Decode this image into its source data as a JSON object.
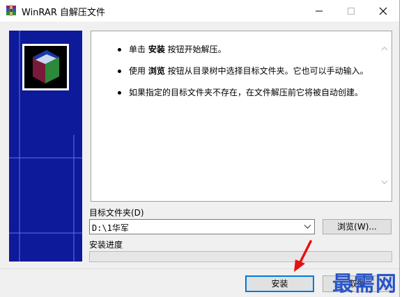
{
  "window": {
    "title": "WinRAR 自解压文件"
  },
  "info": {
    "bullets": [
      {
        "pre": "单击 ",
        "strong": "安装",
        "post": " 按钮开始解压。"
      },
      {
        "pre": "使用 ",
        "strong": "浏览",
        "post": " 按钮从目录树中选择目标文件夹。它也可以手动输入。"
      },
      {
        "pre": "",
        "strong": "",
        "post": "如果指定的目标文件夹不存在，在文件解压前它将被自动创建。"
      }
    ]
  },
  "destination": {
    "label": "目标文件夹(D)",
    "path": "D:\\1华军",
    "browse_label": "浏览(W)..."
  },
  "progress": {
    "label": "安装进度",
    "value": 0
  },
  "footer": {
    "install_label": "安装",
    "cancel_label": "取消"
  },
  "watermark": "最需网",
  "colors": {
    "banner": "#0d1a99",
    "focus_border": "#0078d7",
    "annotation": "#e81010",
    "watermark": "#2a55c8"
  }
}
